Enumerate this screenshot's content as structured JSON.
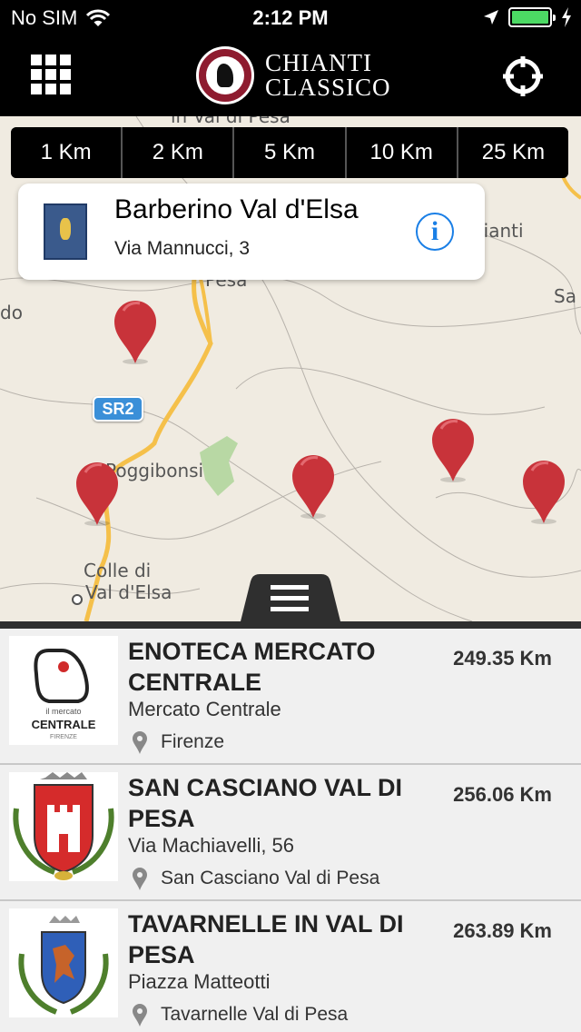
{
  "status_bar": {
    "carrier": "No SIM",
    "time": "2:12 PM",
    "battery_level": 1.0
  },
  "header": {
    "logo_line1": "CHIANTI",
    "logo_line2": "CLASSICO",
    "menu_icon": "grid-icon",
    "locate_icon": "crosshair-icon"
  },
  "distance_filters": [
    {
      "label": "1 Km"
    },
    {
      "label": "2 Km"
    },
    {
      "label": "5 Km"
    },
    {
      "label": "10 Km"
    },
    {
      "label": "25 Km"
    }
  ],
  "map": {
    "labels": {
      "val_di_pesa_top": "in Val di Pesa",
      "chianti": "Chianti",
      "sa": "Sa",
      "do": "do",
      "pesa": "Pesa",
      "poggibonsi": "Poggibonsi",
      "colle_di": "Colle di",
      "val_d_elsa": "Val d'Elsa"
    },
    "road_shield": "SR2",
    "pin_color": "#c8333a"
  },
  "callout": {
    "title": "Barberino Val d'Elsa",
    "subtitle": "Via Mannucci, 3",
    "info_icon": "info-icon"
  },
  "list": {
    "items": [
      {
        "title": "ENOTECA MERCATO CENTRALE",
        "address": "Mercato Centrale",
        "city": "Firenze",
        "distance": "249.35 Km",
        "logo_small": "il mercato",
        "logo_main": "CENTRALE",
        "logo_sub": "FIRENZE"
      },
      {
        "title": "SAN CASCIANO VAL DI PESA",
        "address": "Via Machiavelli, 56",
        "city": "San Casciano Val di Pesa",
        "distance": "256.06 Km"
      },
      {
        "title": "TAVARNELLE IN VAL DI PESA",
        "address": "Piazza Matteotti",
        "city": "Tavarnelle Val di Pesa",
        "distance": "263.89 Km"
      }
    ]
  }
}
